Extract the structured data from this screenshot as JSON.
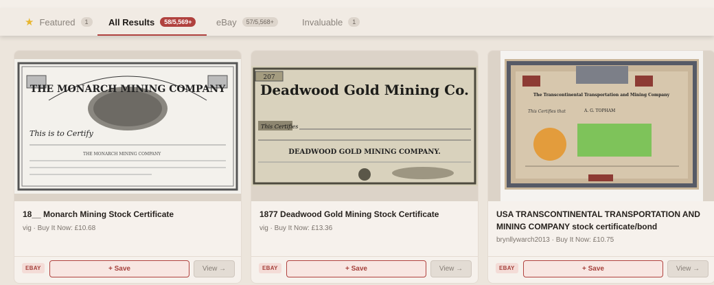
{
  "tabs": [
    {
      "label": "Featured",
      "count": "1",
      "icon": "star-icon"
    },
    {
      "label": "All Results",
      "count": "58/5,569+"
    },
    {
      "label": "eBay",
      "count": "57/5,568+"
    },
    {
      "label": "Invaluable",
      "count": "1"
    }
  ],
  "cards": [
    {
      "title": "18__ Monarch Mining Stock Certificate",
      "meta": "vig · Buy It Now: £10.68",
      "source": "EBAY",
      "save_label": "+ Save",
      "view_label": "View →",
      "image": {
        "header": "THE MONARCH MINING COMPANY",
        "line": "This is to Certify",
        "sub": "THE MONARCH MINING COMPANY"
      }
    },
    {
      "title": "1877 Deadwood Gold Mining Stock Certificate",
      "meta": "vig · Buy It Now: £13.36",
      "source": "EBAY",
      "save_label": "+ Save",
      "view_label": "View →",
      "image": {
        "header": "Deadwood Gold Mining Co.",
        "line": "This Certifies",
        "sub": "DEADWOOD GOLD MINING COMPANY.",
        "number": "207"
      }
    },
    {
      "title": "USA TRANSCONTINENTAL TRANSPORTATION AND MINING COMPANY stock certificate/bond",
      "meta": "brynllywarch2013 · Buy It Now: £10.75",
      "source": "EBAY",
      "save_label": "+ Save",
      "view_label": "View →",
      "image": {
        "header": "The Transcontinental Transportation and Mining Company",
        "name": "A. G. TOPHAM",
        "line": "This Certifies that"
      }
    }
  ],
  "colors": {
    "accent": "#b0413e",
    "badge_active": "#b0413e",
    "background": "#ece5dc"
  }
}
